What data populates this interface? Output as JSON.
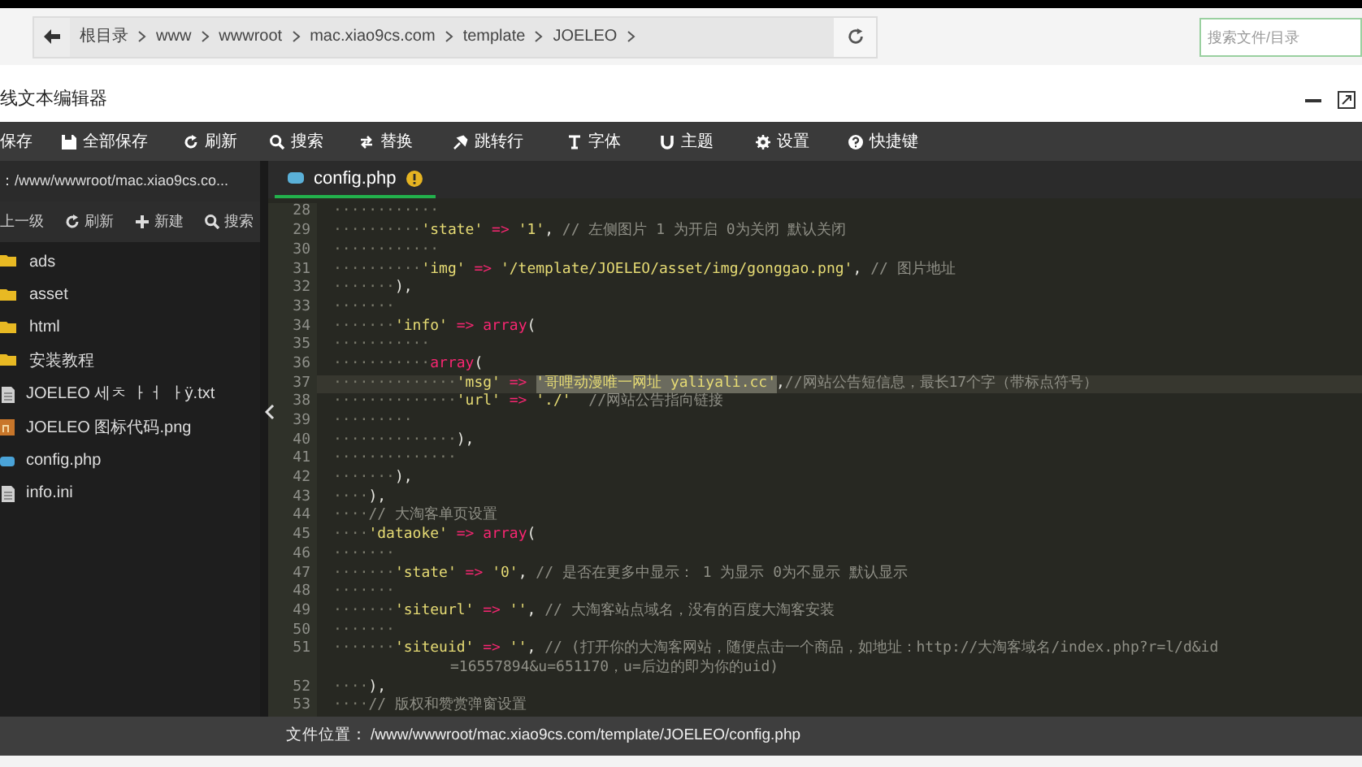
{
  "browser_bar": {
    "breadcrumbs": [
      "根目录",
      "www",
      "wwwroot",
      "mac.xiao9cs.com",
      "template",
      "JOELEO"
    ],
    "search": {
      "placeholder": "搜索文件/目录"
    }
  },
  "window": {
    "title": "线文本编辑器"
  },
  "toolbar": [
    "保存",
    "全部保存",
    "刷新",
    "搜索",
    "替换",
    "跳转行",
    "字体",
    "主题",
    "设置",
    "快捷键"
  ],
  "sidebar": {
    "path": "：/www/wwwroot/mac.xiao9cs.co...",
    "actions": [
      "上一级",
      "刷新",
      "新建",
      "搜索"
    ],
    "items": [
      {
        "name": "ads",
        "kind": "folder"
      },
      {
        "name": "asset",
        "kind": "folder"
      },
      {
        "name": "html",
        "kind": "folder"
      },
      {
        "name": "安装教程",
        "kind": "folder"
      },
      {
        "name": "JOELEO 세ㅊ ㅏㅓ ㅏÿ.txt",
        "kind": "text"
      },
      {
        "name": "JOELEO 图标代码.png",
        "kind": "image"
      },
      {
        "name": "config.php",
        "kind": "php"
      },
      {
        "name": "info.ini",
        "kind": "text"
      }
    ]
  },
  "tabs": [
    {
      "label": "config.php",
      "selected": true,
      "modified": true
    }
  ],
  "code_lines": [
    {
      "number": "28",
      "segments": [
        {
          "kind": "ws",
          "text": "············"
        }
      ]
    },
    {
      "number": "29",
      "segments": [
        {
          "kind": "ws",
          "text": "··········"
        },
        {
          "kind": "str",
          "text": "'state'"
        },
        {
          "kind": "op",
          "text": " => "
        },
        {
          "kind": "str",
          "text": "'1'"
        },
        {
          "kind": "plain",
          "text": ", "
        },
        {
          "kind": "comment",
          "text": "// 左侧图片 1 为开启 0为关闭 默认关闭"
        }
      ]
    },
    {
      "number": "30",
      "segments": [
        {
          "kind": "ws",
          "text": "············"
        }
      ]
    },
    {
      "number": "31",
      "segments": [
        {
          "kind": "ws",
          "text": "··········"
        },
        {
          "kind": "str",
          "text": "'img'"
        },
        {
          "kind": "op",
          "text": " => "
        },
        {
          "kind": "str",
          "text": "'/template/JOELEO/asset/img/gonggao.png'"
        },
        {
          "kind": "plain",
          "text": ", "
        },
        {
          "kind": "comment",
          "text": "// 图片地址"
        }
      ]
    },
    {
      "number": "32",
      "segments": [
        {
          "kind": "ws",
          "text": "·······"
        },
        {
          "kind": "plain",
          "text": "),"
        }
      ]
    },
    {
      "number": "33",
      "segments": [
        {
          "kind": "ws",
          "text": "·······"
        }
      ]
    },
    {
      "number": "34",
      "segments": [
        {
          "kind": "ws",
          "text": "·······"
        },
        {
          "kind": "str",
          "text": "'info'"
        },
        {
          "kind": "op",
          "text": " => "
        },
        {
          "kind": "kw",
          "text": "array"
        },
        {
          "kind": "plain",
          "text": "("
        }
      ]
    },
    {
      "number": "35",
      "segments": [
        {
          "kind": "ws",
          "text": "···········"
        }
      ]
    },
    {
      "number": "36",
      "segments": [
        {
          "kind": "ws",
          "text": "···········"
        },
        {
          "kind": "kw",
          "text": "array"
        },
        {
          "kind": "plain",
          "text": "("
        }
      ]
    },
    {
      "number": "37",
      "active": true,
      "segments": [
        {
          "kind": "ws",
          "text": "··············"
        },
        {
          "kind": "str",
          "text": "'msg'"
        },
        {
          "kind": "op",
          "text": " => "
        },
        {
          "kind": "selection",
          "text": "'哥哩动漫唯一网址 yaliyali.cc'"
        },
        {
          "kind": "plain",
          "text": ","
        },
        {
          "kind": "comment",
          "text": "//网站公告短信息，最长17个字（带标点符号）"
        }
      ]
    },
    {
      "number": "38",
      "segments": [
        {
          "kind": "ws",
          "text": "··············"
        },
        {
          "kind": "str",
          "text": "'url'"
        },
        {
          "kind": "op",
          "text": " => "
        },
        {
          "kind": "str",
          "text": "'./'"
        },
        {
          "kind": "comment",
          "text": "  //网站公告指向链接"
        }
      ]
    },
    {
      "number": "39",
      "segments": [
        {
          "kind": "ws",
          "text": "·········"
        }
      ]
    },
    {
      "number": "40",
      "segments": [
        {
          "kind": "ws",
          "text": "··············"
        },
        {
          "kind": "plain",
          "text": "),"
        }
      ]
    },
    {
      "number": "41",
      "segments": [
        {
          "kind": "ws",
          "text": "··············"
        }
      ]
    },
    {
      "number": "42",
      "segments": [
        {
          "kind": "ws",
          "text": "·······"
        },
        {
          "kind": "plain",
          "text": "),"
        }
      ]
    },
    {
      "number": "43",
      "segments": [
        {
          "kind": "ws",
          "text": "····"
        },
        {
          "kind": "plain",
          "text": "),"
        }
      ]
    },
    {
      "number": "44",
      "segments": [
        {
          "kind": "ws",
          "text": "····"
        },
        {
          "kind": "comment",
          "text": "// 大淘客单页设置"
        }
      ]
    },
    {
      "number": "45",
      "segments": [
        {
          "kind": "ws",
          "text": "····"
        },
        {
          "kind": "str",
          "text": "'dataoke'"
        },
        {
          "kind": "op",
          "text": " => "
        },
        {
          "kind": "kw",
          "text": "array"
        },
        {
          "kind": "plain",
          "text": "("
        }
      ]
    },
    {
      "number": "46",
      "segments": [
        {
          "kind": "ws",
          "text": "·······"
        }
      ]
    },
    {
      "number": "47",
      "segments": [
        {
          "kind": "ws",
          "text": "·······"
        },
        {
          "kind": "str",
          "text": "'state'"
        },
        {
          "kind": "op",
          "text": " => "
        },
        {
          "kind": "str",
          "text": "'0'"
        },
        {
          "kind": "plain",
          "text": ", "
        },
        {
          "kind": "comment",
          "text": "// 是否在更多中显示： 1 为显示 0为不显示 默认显示"
        }
      ]
    },
    {
      "number": "48",
      "segments": [
        {
          "kind": "ws",
          "text": "·······"
        }
      ]
    },
    {
      "number": "49",
      "segments": [
        {
          "kind": "ws",
          "text": "·······"
        },
        {
          "kind": "str",
          "text": "'siteurl'"
        },
        {
          "kind": "op",
          "text": " => "
        },
        {
          "kind": "str",
          "text": "''"
        },
        {
          "kind": "plain",
          "text": ", "
        },
        {
          "kind": "comment",
          "text": "// 大淘客站点域名，没有的百度大淘客安装"
        }
      ]
    },
    {
      "number": "50",
      "segments": [
        {
          "kind": "ws",
          "text": "·······"
        }
      ]
    },
    {
      "number": "51",
      "segments": [
        {
          "kind": "ws",
          "text": "·······"
        },
        {
          "kind": "str",
          "text": "'siteuid'"
        },
        {
          "kind": "op",
          "text": " => "
        },
        {
          "kind": "str",
          "text": "''"
        },
        {
          "kind": "plain",
          "text": ", "
        },
        {
          "kind": "comment",
          "text": "// (打开你的大淘客网站，随便点击一个商品，如地址：http://大淘客域名/index.php?r=l/d&id"
        }
      ]
    },
    {
      "continuation": true,
      "segments": [
        {
          "kind": "comment",
          "text": "=16557894&u=651170，u=后边的即为你的uid)"
        }
      ]
    },
    {
      "number": "52",
      "segments": [
        {
          "kind": "ws",
          "text": "····"
        },
        {
          "kind": "plain",
          "text": "),"
        }
      ]
    },
    {
      "number": "53",
      "segments": [
        {
          "kind": "ws",
          "text": "····"
        },
        {
          "kind": "comment",
          "text": "// 版权和赞赏弹窗设置"
        }
      ]
    }
  ],
  "status_bar": {
    "label": "文件位置：",
    "path": "/www/wwwroot/mac.xiao9cs.com/template/JOELEO/config.php"
  }
}
